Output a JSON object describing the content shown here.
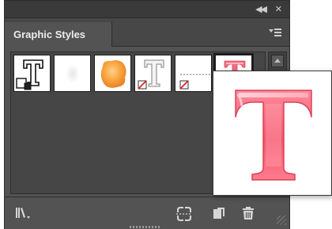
{
  "panel": {
    "tab_label": "Graphic Styles",
    "titlebar": {
      "collapse_glyph": "◀◀",
      "close_glyph": "✕"
    }
  },
  "swatches": [
    {
      "name": "default-type-style",
      "icon": "outlined-T-with-fill-squares-icon"
    },
    {
      "name": "soft-glow-style",
      "icon": "faint-blob-icon"
    },
    {
      "name": "orange-blob-style",
      "icon": "orange-blob-icon"
    },
    {
      "name": "outlined-T-none-style",
      "icon": "gray-T-with-none-icon"
    },
    {
      "name": "dotted-line-none-style",
      "icon": "dotted-line-with-none-icon"
    },
    {
      "name": "pink-3d-T-style",
      "icon": "pink-T-icon",
      "selected": true
    }
  ],
  "preview": {
    "glyph": "T",
    "fill_color": "#f25a6e",
    "highlight_color": "#ffd0d6"
  },
  "bottom_toolbar": [
    {
      "name": "graphic-styles-libraries-menu",
      "icon": "libraries-icon"
    },
    {
      "name": "break-link-to-style",
      "icon": "break-link-icon"
    },
    {
      "name": "new-graphic-style",
      "icon": "new-item-icon"
    },
    {
      "name": "delete-graphic-style",
      "icon": "trash-icon"
    }
  ],
  "colors": {
    "panel_bg": "#535353",
    "titlebar_bg": "#3a3a3a",
    "text": "#ececec",
    "accent_pink": "#f25a6e"
  }
}
